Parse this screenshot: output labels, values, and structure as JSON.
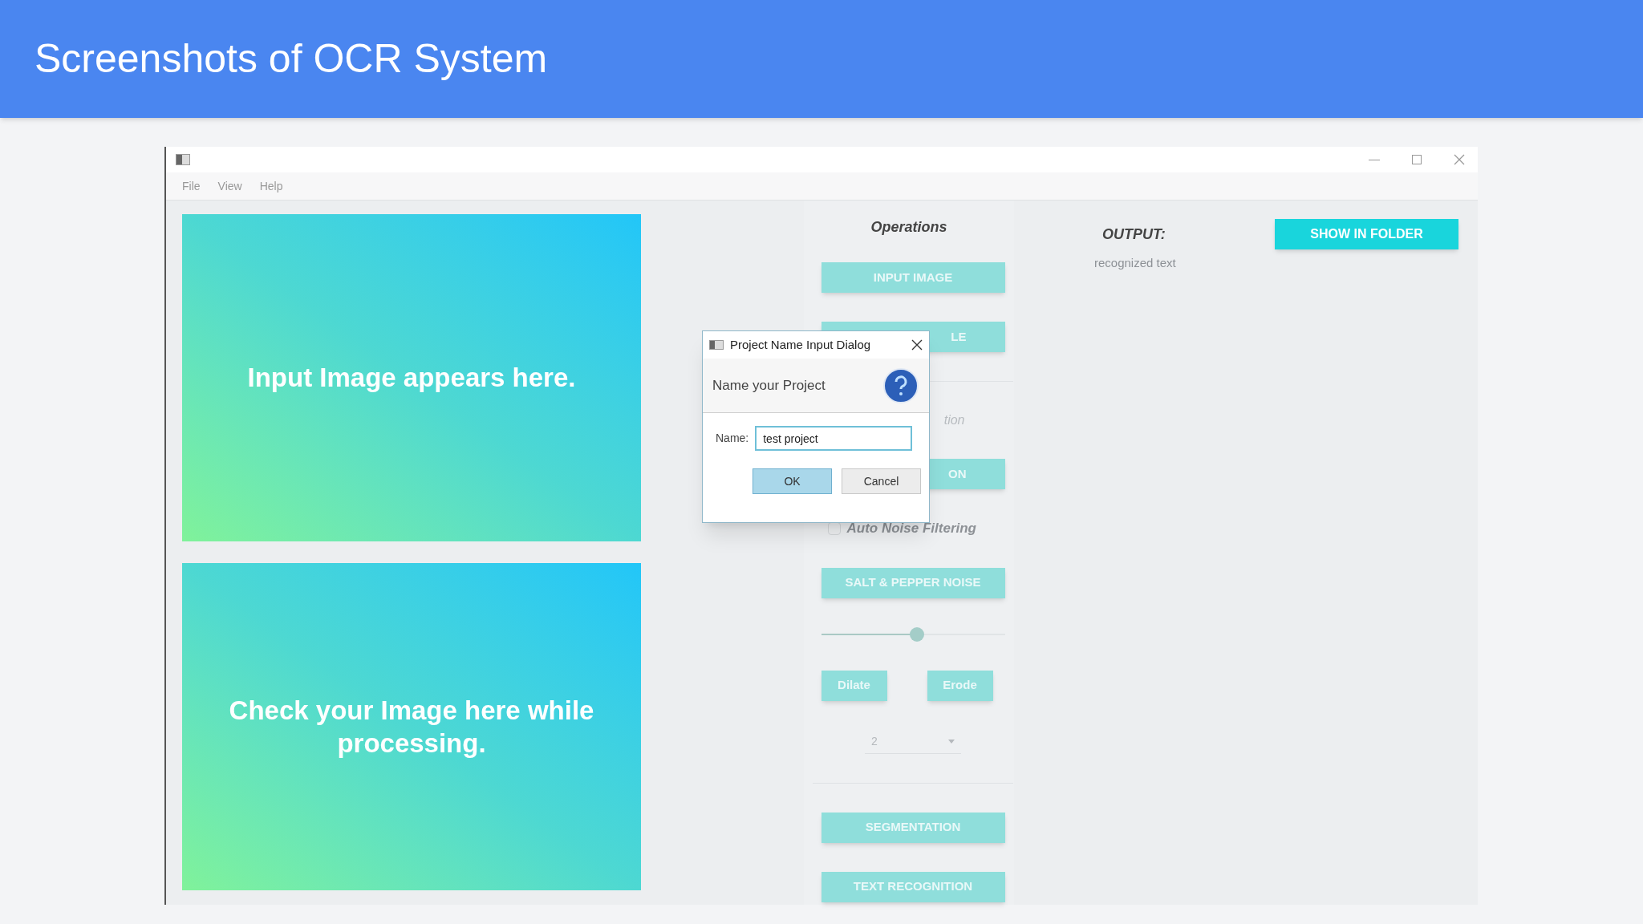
{
  "slide": {
    "title": "Screenshots of OCR System"
  },
  "window": {
    "menu": [
      "File",
      "View",
      "Help"
    ]
  },
  "panels": [
    "Input Image appears here.",
    "Check your Image here while processing."
  ],
  "operations": {
    "heading": "Operations",
    "items": [
      {
        "kind": "button",
        "label": "INPUT IMAGE",
        "covered": false
      },
      {
        "kind": "button",
        "label": "LE",
        "covered": true
      },
      {
        "kind": "divider"
      },
      {
        "kind": "label",
        "label": "tion",
        "covered": true
      },
      {
        "kind": "button",
        "label": "ON",
        "covered": true
      },
      {
        "kind": "checkbox",
        "label": "Auto Noise Filtering",
        "checked": false
      },
      {
        "kind": "button",
        "label": "SALT & PEPPER NOISE",
        "covered": false
      },
      {
        "kind": "slider",
        "level": 0.52
      },
      {
        "kind": "pair",
        "labels": [
          "Dilate",
          "Erode"
        ]
      },
      {
        "kind": "dropdown",
        "value": "2"
      },
      {
        "kind": "divider"
      },
      {
        "kind": "button",
        "label": "SEGMENTATION",
        "covered": false
      },
      {
        "kind": "button",
        "label": "TEXT RECOGNITION",
        "covered": false
      }
    ]
  },
  "output": {
    "heading": "OUTPUT:",
    "button": "SHOW IN FOLDER",
    "text": "recognized text"
  },
  "dialog": {
    "title": "Project Name Input Dialog",
    "message": "Name your Project",
    "field_label": "Name:",
    "value": "test project",
    "buttons": [
      {
        "label": "OK",
        "selected": true
      },
      {
        "label": "Cancel",
        "selected": false
      }
    ]
  }
}
